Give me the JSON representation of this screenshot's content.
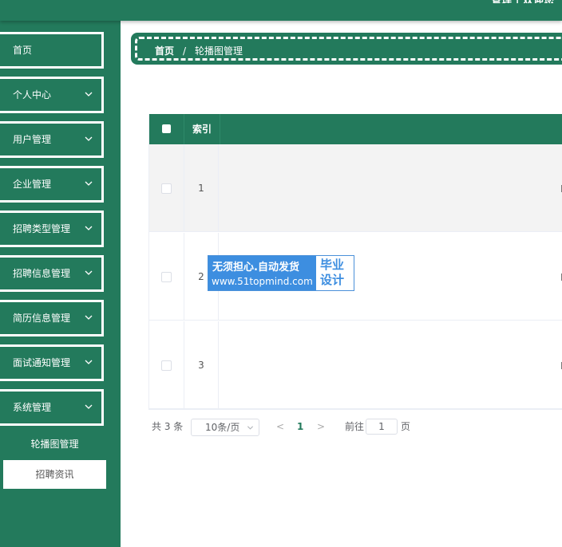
{
  "header": {
    "user_text": "管理 | 欢迎您"
  },
  "colors": {
    "primary": "#237a5c",
    "watermark_blue": "#3d8ee0"
  },
  "sidebar": {
    "items": [
      {
        "label": "首页",
        "has_chevron": false
      },
      {
        "label": "个人中心",
        "has_chevron": true
      },
      {
        "label": "用户管理",
        "has_chevron": true
      },
      {
        "label": "企业管理",
        "has_chevron": true
      },
      {
        "label": "招聘类型管理",
        "has_chevron": true
      },
      {
        "label": "招聘信息管理",
        "has_chevron": true
      },
      {
        "label": "简历信息管理",
        "has_chevron": true
      },
      {
        "label": "面试通知管理",
        "has_chevron": true
      },
      {
        "label": "系统管理",
        "has_chevron": true
      }
    ],
    "submenu": [
      {
        "label": "轮播图管理",
        "active": true
      },
      {
        "label": "招聘资讯",
        "active": false
      }
    ]
  },
  "breadcrumb": {
    "home": "首页",
    "separator": "/",
    "current": "轮播图管理"
  },
  "table": {
    "header_index": "索引",
    "rows": [
      {
        "index": "1"
      },
      {
        "index": "2"
      },
      {
        "index": "3"
      }
    ]
  },
  "pagination": {
    "total": "共 3 条",
    "page_size": "10条/页",
    "prev": "<",
    "current_page": "1",
    "next": ">",
    "goto_label": "前往",
    "goto_value": "1",
    "page_label": "页"
  },
  "watermark": {
    "line1": "无须担心.自动发货",
    "line2": "www.51topmind.com",
    "right_line1": "毕业",
    "right_line2": "设计"
  }
}
